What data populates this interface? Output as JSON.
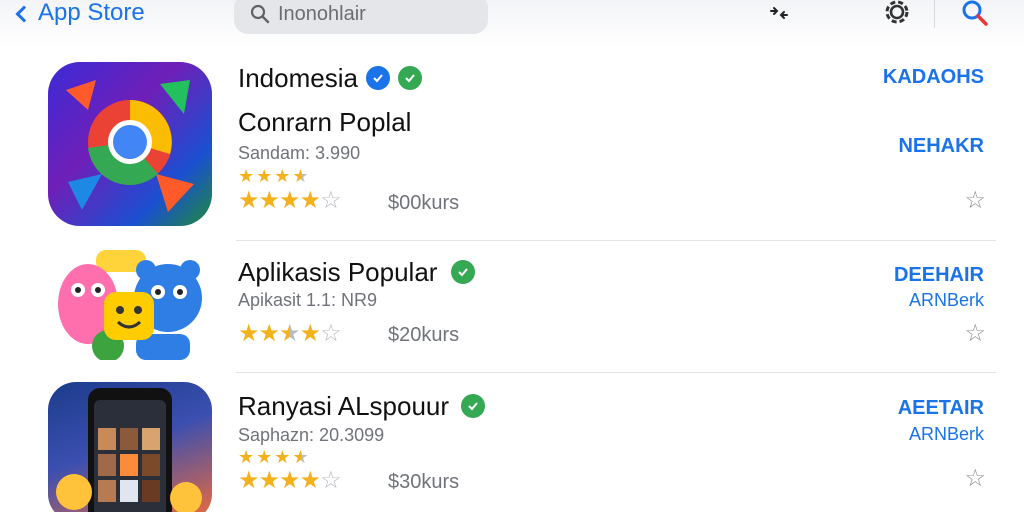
{
  "header": {
    "back_label": "App Store",
    "search_value": "Inonohlair",
    "icons": [
      "chevron-left-icon",
      "search-icon",
      "transfer-arrows-icon",
      "gear-icon",
      "search-icon"
    ]
  },
  "colors": {
    "accent": "#1a73e8",
    "star": "#f3b21c",
    "verified_blue": "#1a73e8",
    "verified_green": "#34a853"
  },
  "apps": [
    {
      "title": "Indomesia",
      "subtitle": "Conrarn Poplal",
      "meta": "Sandam: 3.990",
      "price": "$00kurs",
      "badges": [
        "blue-check",
        "green-check"
      ],
      "rating_small": 3.5,
      "rating": 4.5,
      "label1": "KADAOHS",
      "label2": "NEHAKR"
    },
    {
      "title": "Aplikasis Popular",
      "meta": "Apikasit 1.1: NR9",
      "price": "$20kurs",
      "badges": [
        "green-check"
      ],
      "rating": 3.5,
      "label1": "DEEHAIR",
      "label2": "ARNBerk"
    },
    {
      "title": "Ranyasi ALspouur",
      "meta": "Saphazn: 20.3099",
      "price": "$30kurs",
      "badges": [
        "green-check"
      ],
      "rating_small": 3.5,
      "rating": 4.5,
      "label1": "AEETAIR",
      "label2": "ARNBerk"
    }
  ]
}
